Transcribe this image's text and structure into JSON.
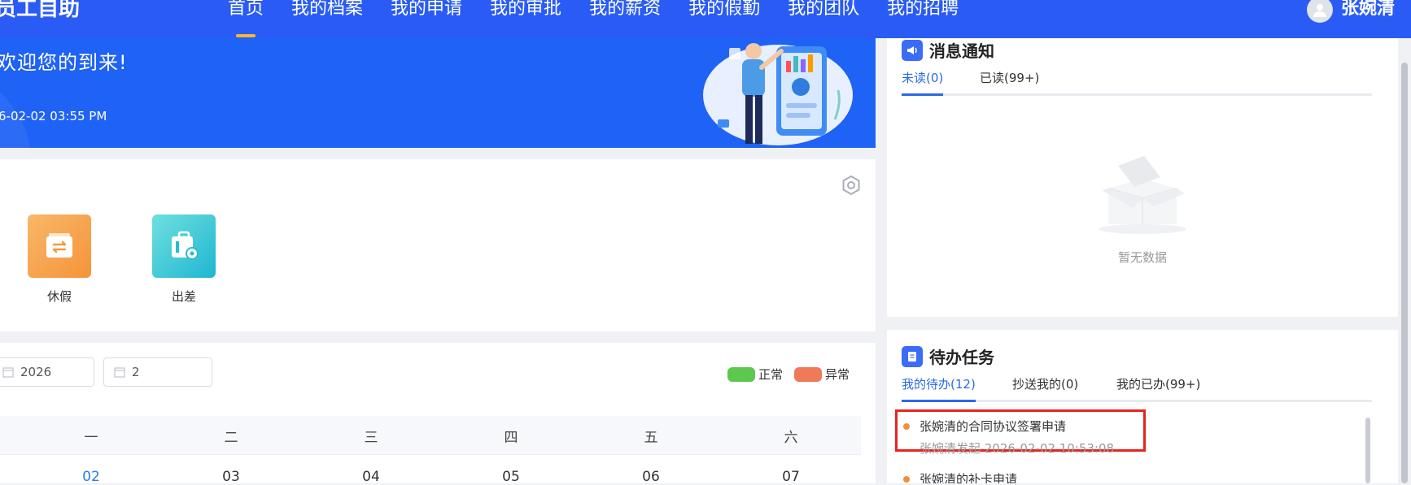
{
  "app": {
    "brand": "员工自助"
  },
  "nav": {
    "items": [
      {
        "label": "首页",
        "active": true
      },
      {
        "label": "我的档案"
      },
      {
        "label": "我的申请"
      },
      {
        "label": "我的审批"
      },
      {
        "label": "我的薪资"
      },
      {
        "label": "我的假勤"
      },
      {
        "label": "我的团队"
      },
      {
        "label": "我的招聘"
      }
    ],
    "user_name": "张婉清",
    "active_color": "#f5b73a"
  },
  "banner": {
    "welcome": "欢迎您的到来!",
    "datetime": "6-02-02 03:55 PM",
    "background": "#1f62f6"
  },
  "shortcuts": {
    "items": [
      {
        "label": "休假",
        "icon": "leave-swap-icon",
        "color": "#f6a046"
      },
      {
        "label": "出差",
        "icon": "business-trip-icon",
        "color": "#3ec9d6"
      }
    ]
  },
  "calendar": {
    "year": "2026",
    "month": "2",
    "legend": [
      {
        "label": "正常",
        "color": "#5cc84d"
      },
      {
        "label": "异常",
        "color": "#f0795a"
      }
    ],
    "weekdays": [
      "一",
      "二",
      "三",
      "四",
      "五",
      "六"
    ],
    "days": [
      "02",
      "03",
      "04",
      "05",
      "06",
      "07"
    ],
    "today": "02"
  },
  "notice": {
    "title": "消息通知",
    "tabs": [
      {
        "label": "未读(0)",
        "active": true
      },
      {
        "label": "已读(99+)"
      }
    ],
    "empty_text": "暂无数据"
  },
  "tasks": {
    "title": "待办任务",
    "tabs": [
      {
        "label": "我的待办(12)",
        "active": true
      },
      {
        "label": "抄送我的(0)"
      },
      {
        "label": "我的已办(99+)"
      }
    ],
    "items": [
      {
        "title": "张婉清的合同协议签署申请",
        "meta": "张婉清发起  2026-02-02 10:53:08"
      },
      {
        "title": "张婉清的补卡申请",
        "meta": ""
      }
    ]
  }
}
